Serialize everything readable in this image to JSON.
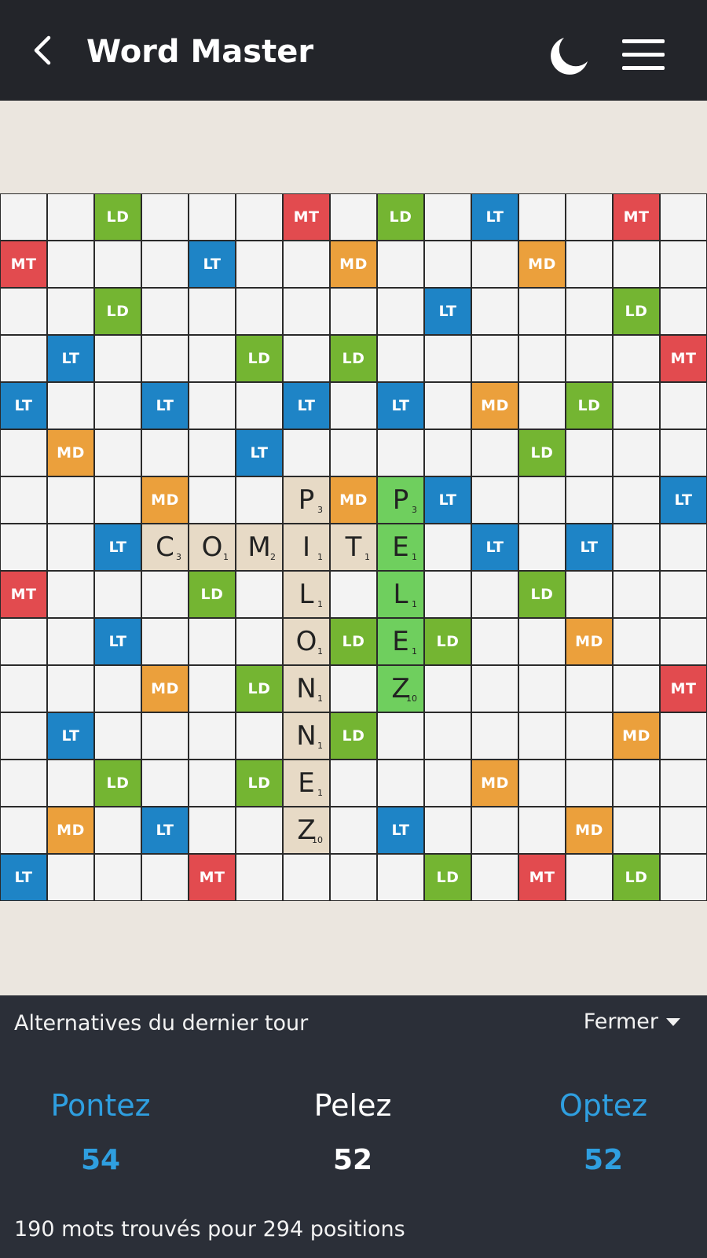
{
  "header": {
    "title": "Word Master",
    "back_icon": "chevron-left-icon",
    "night_icon": "moon-icon",
    "menu_icon": "hamburger-menu-icon"
  },
  "colors": {
    "LD": "#74b532",
    "LT": "#1e84c6",
    "MD": "#eba03c",
    "MT": "#e24b4f",
    "tile": "#e7dac6",
    "new_tile": "#6fcf5e"
  },
  "board": {
    "size": 15,
    "rows": [
      [
        "",
        "",
        "LD",
        "",
        "",
        "",
        "MT",
        "",
        "LD",
        "",
        "LT",
        "",
        "",
        "MT",
        ""
      ],
      [
        "MT",
        "",
        "",
        "",
        "LT",
        "",
        "",
        "MD",
        "",
        "",
        "",
        "MD",
        "",
        "",
        ""
      ],
      [
        "",
        "",
        "LD",
        "",
        "",
        "",
        "",
        "",
        "",
        "LT",
        "",
        "",
        "",
        "LD",
        ""
      ],
      [
        "",
        "LT",
        "",
        "",
        "",
        "LD",
        "",
        "LD",
        "",
        "",
        "",
        "",
        "",
        "",
        "MT"
      ],
      [
        "LT",
        "",
        "",
        "LT",
        "",
        "",
        "LT",
        "",
        "LT",
        "",
        "MD",
        "",
        "LD",
        "",
        ""
      ],
      [
        "",
        "MD",
        "",
        "",
        "",
        "LT",
        "",
        "",
        "",
        "",
        "",
        "LD",
        "",
        "",
        ""
      ],
      [
        "",
        "",
        "",
        "MD",
        "",
        "",
        "P:3",
        "MD",
        "P:3*",
        "LT",
        "",
        "",
        "",
        "",
        "LT"
      ],
      [
        "",
        "",
        "LT",
        "C:3",
        "O:1",
        "M:2",
        "I:1",
        "T:1",
        "E:1*",
        "",
        "LT",
        "",
        "LT",
        "",
        ""
      ],
      [
        "MT",
        "",
        "",
        "",
        "LD",
        "",
        "L:1",
        "",
        "L:1*",
        "",
        "",
        "LD",
        "",
        "",
        ""
      ],
      [
        "",
        "",
        "LT",
        "",
        "",
        "",
        "O:1",
        "LD",
        "E:1*",
        "LD",
        "",
        "",
        "MD",
        "",
        ""
      ],
      [
        "",
        "",
        "",
        "MD",
        "",
        "LD",
        "N:1",
        "",
        "Z:10*",
        "",
        "",
        "",
        "",
        "",
        "MT"
      ],
      [
        "",
        "LT",
        "",
        "",
        "",
        "",
        "N:1",
        "LD",
        "",
        "",
        "",
        "",
        "",
        "MD",
        ""
      ],
      [
        "",
        "",
        "LD",
        "",
        "",
        "LD",
        "E:1",
        "",
        "",
        "",
        "MD",
        "",
        "",
        "",
        ""
      ],
      [
        "",
        "MD",
        "",
        "LT",
        "",
        "",
        "Z:10",
        "",
        "LT",
        "",
        "",
        "",
        "MD",
        "",
        ""
      ],
      [
        "LT",
        "",
        "",
        "",
        "MT",
        "",
        "",
        "",
        "",
        "LD",
        "",
        "MT",
        "",
        "LD",
        ""
      ]
    ]
  },
  "alternatives": {
    "title": "Alternatives du dernier tour",
    "close_label": "Fermer",
    "close_icon": "caret-down-icon",
    "items": [
      {
        "word": "Pontez",
        "score": "54",
        "color": "#2f9fe0"
      },
      {
        "word": "Pelez",
        "score": "52",
        "color": "#ffffff"
      },
      {
        "word": "Optez",
        "score": "52",
        "color": "#2f9fe0"
      }
    ],
    "summary": "190 mots trouvés pour 294 positions"
  }
}
